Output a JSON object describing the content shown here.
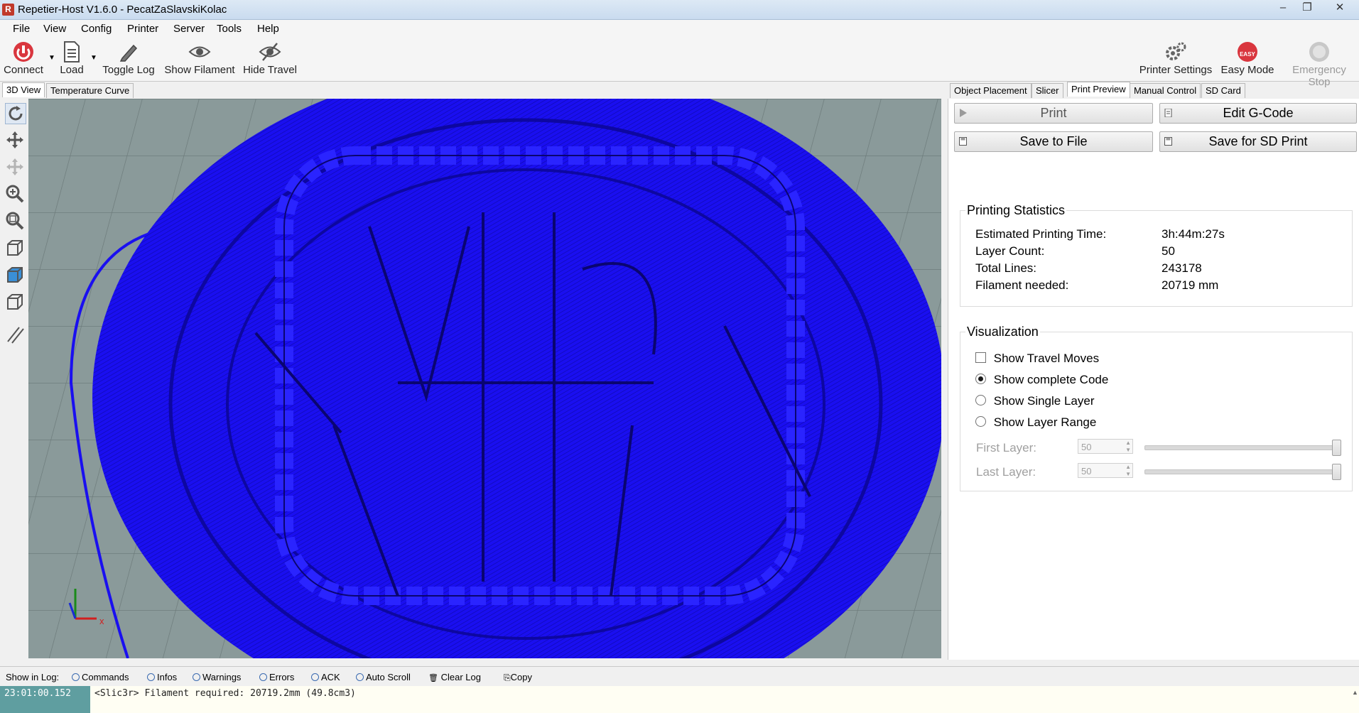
{
  "window": {
    "title": "Repetier-Host V1.6.0 - PecatZaSlavskiKolac",
    "app_icon_letter": "R"
  },
  "menu": [
    "File",
    "View",
    "Config",
    "Printer",
    "Server",
    "Tools",
    "Help"
  ],
  "toolbar": {
    "connect": "Connect",
    "load": "Load",
    "toggle_log": "Toggle Log",
    "show_filament": "Show Filament",
    "hide_travel": "Hide Travel",
    "printer_settings": "Printer Settings",
    "easy_mode": "Easy Mode",
    "easy_badge": "EASY",
    "emergency_stop": "Emergency Stop"
  },
  "left_tabs": [
    "3D View",
    "Temperature Curve"
  ],
  "right_tabs": [
    "Object Placement",
    "Slicer",
    "Print Preview",
    "Manual Control",
    "SD Card"
  ],
  "actions": {
    "print": "Print",
    "edit_gcode": "Edit G-Code",
    "save_to_file": "Save to File",
    "save_for_sd": "Save for SD Print"
  },
  "stats": {
    "title": "Printing Statistics",
    "rows": [
      {
        "label": "Estimated Printing Time:",
        "value": "3h:44m:27s"
      },
      {
        "label": "Layer Count:",
        "value": "50"
      },
      {
        "label": "Total Lines:",
        "value": "243178"
      },
      {
        "label": "Filament needed:",
        "value": "20719 mm"
      }
    ]
  },
  "visualization": {
    "title": "Visualization",
    "show_travel": "Show Travel Moves",
    "show_complete": "Show complete Code",
    "show_single": "Show Single Layer",
    "show_range": "Show Layer Range",
    "first_layer_label": "First Layer:",
    "first_layer_value": "50",
    "last_layer_label": "Last Layer:",
    "last_layer_value": "50",
    "selected": "show_complete"
  },
  "log": {
    "show_in_log": "Show in Log:",
    "options": [
      "Commands",
      "Infos",
      "Warnings",
      "Errors",
      "ACK",
      "Auto Scroll"
    ],
    "clear": "Clear Log",
    "copy": "Copy",
    "time": "23:01:00.152",
    "message": "<Slic3r> Filament required: 20719.2mm (49.8cm3)"
  },
  "colors": {
    "model": "#1a0ff0",
    "connect_icon": "#d9363e",
    "bed": "#8a9a9a",
    "log_time_bg": "#5f9ea0"
  }
}
